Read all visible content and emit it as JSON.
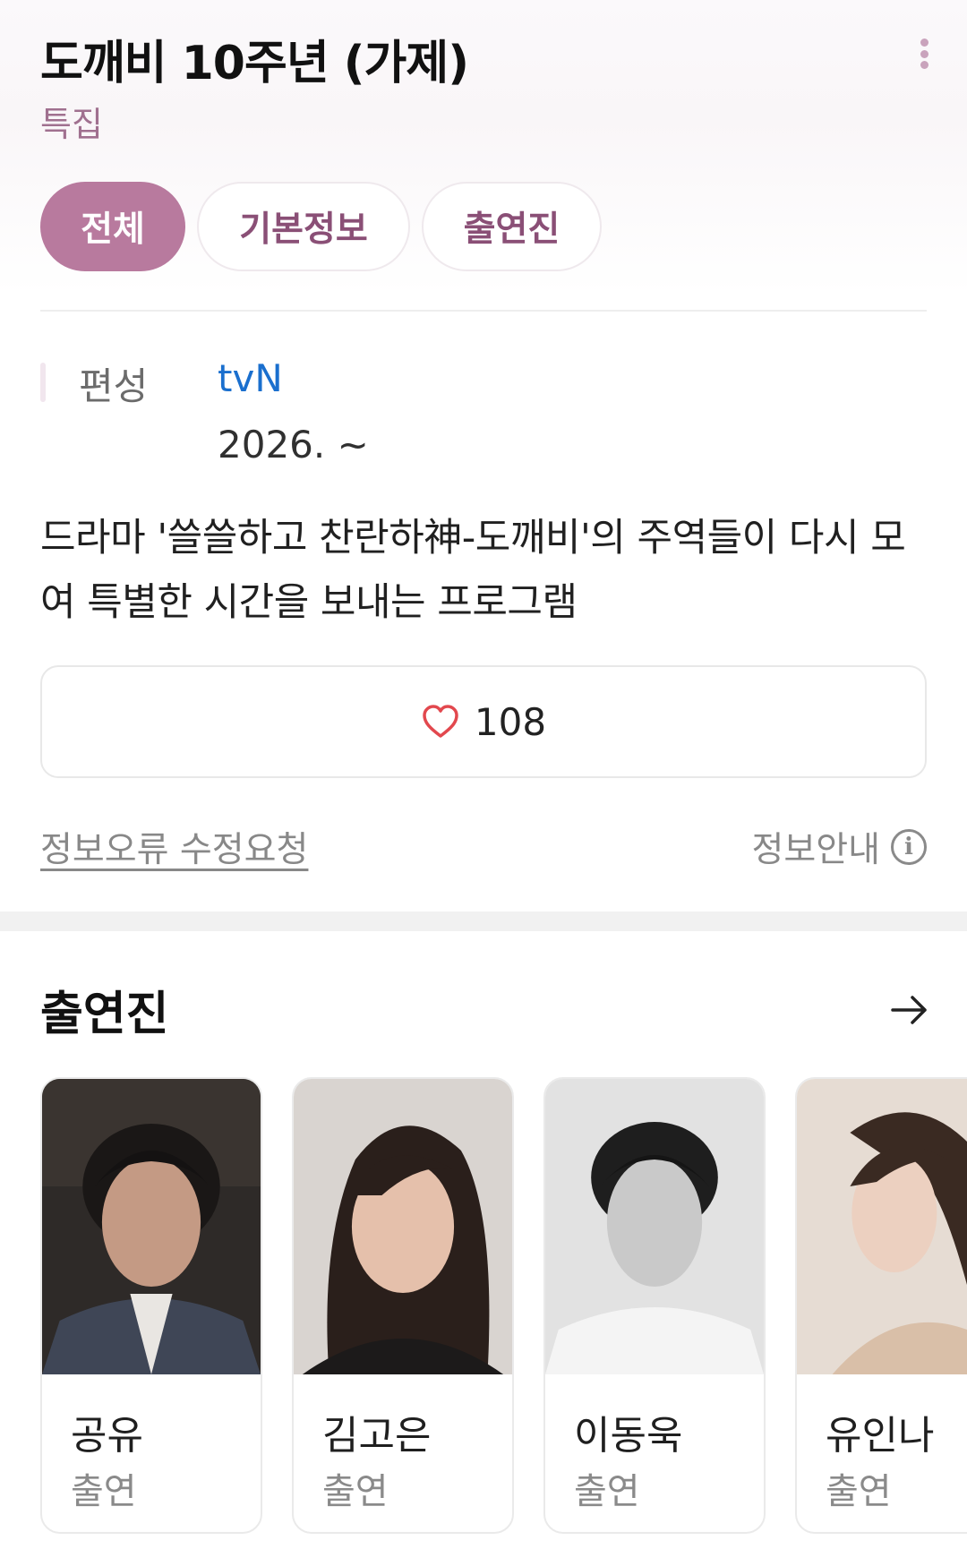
{
  "header": {
    "title": "도깨비 10주년 (가제)",
    "subtitle": "특집"
  },
  "tabs": [
    {
      "label": "전체",
      "active": true
    },
    {
      "label": "기본정보",
      "active": false
    },
    {
      "label": "출연진",
      "active": false
    }
  ],
  "info": {
    "label": "편성",
    "network": "tvN",
    "date": "2026. ~"
  },
  "description": "드라마 '쓸쓸하고 찬란하神-도깨비'의 주역들이 다시 모여 특별한 시간을 보내는 프로그램",
  "like": {
    "count": "108",
    "icon": "heart-icon"
  },
  "links": {
    "report": "정보오류 수정요청",
    "info": "정보안내"
  },
  "cast_section": {
    "title": "출연진",
    "members": [
      {
        "name": "공유",
        "role": "출연"
      },
      {
        "name": "김고은",
        "role": "출연"
      },
      {
        "name": "이동욱",
        "role": "출연"
      },
      {
        "name": "유인나",
        "role": "출연"
      }
    ]
  },
  "colors": {
    "accent": "#b87a9e",
    "subtitle": "#a0708f",
    "link": "#1a6fce",
    "heart": "#e2484e"
  }
}
